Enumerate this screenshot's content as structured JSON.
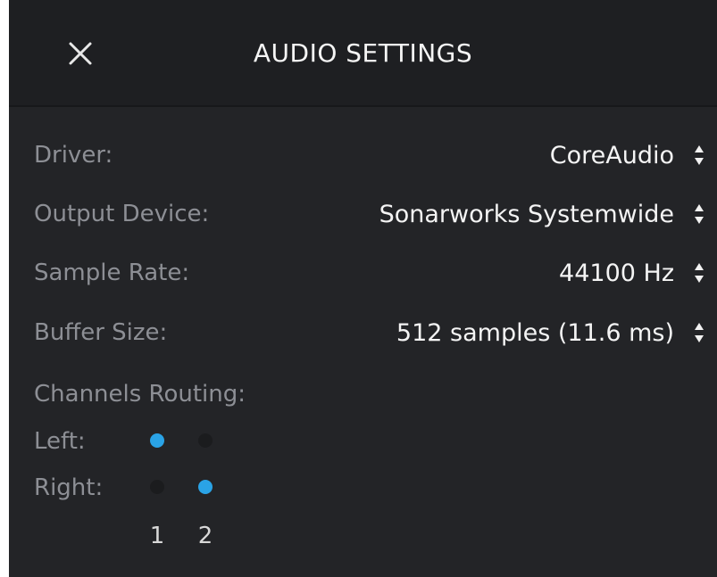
{
  "header": {
    "title": "AUDIO SETTINGS",
    "close_icon": "close-icon"
  },
  "settings": [
    {
      "label": "Driver:",
      "value": "CoreAudio"
    },
    {
      "label": "Output Device:",
      "value": "Sonarworks Systemwide"
    },
    {
      "label": "Sample Rate:",
      "value": "44100 Hz"
    },
    {
      "label": "Buffer Size:",
      "value": "512 samples (11.6 ms)"
    }
  ],
  "routing": {
    "heading": "Channels Routing:",
    "rows": [
      {
        "label": "Left:",
        "channels": [
          true,
          false
        ]
      },
      {
        "label": "Right:",
        "channels": [
          false,
          true
        ]
      }
    ],
    "channel_numbers": [
      "1",
      "2"
    ]
  },
  "colors": {
    "panel_background": "#232427",
    "header_background": "#1e1f22",
    "label_text": "#8d8f95",
    "value_text": "#f4f4f4",
    "routing_active": "#2aa3e6",
    "routing_inactive": "#1b1c1e"
  }
}
